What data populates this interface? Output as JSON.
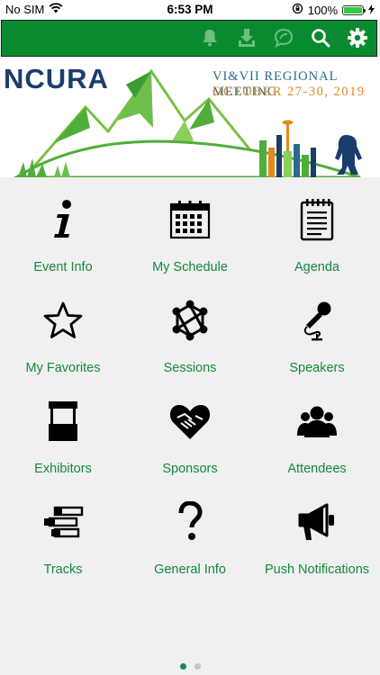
{
  "status_bar": {
    "carrier": "No SIM",
    "time": "6:53 PM",
    "battery": "100%",
    "battery_level": 1.0,
    "wifi_icon": "wifi-icon",
    "rotation_lock_icon": "rotation-lock-icon",
    "charging_icon": "charging-bolt-icon"
  },
  "toolbar": {
    "background": "#0a8a2e",
    "icons": [
      "bell-icon",
      "download-icon",
      "chat-bubble-icon",
      "search-icon",
      "gear-icon"
    ]
  },
  "banner": {
    "logo_text": "NCURA",
    "meeting_title": "VI&VII REGIONAL MEETING",
    "meeting_dates": "OCTOBER 27-30, 2019"
  },
  "menu": [
    {
      "label": "Event Info",
      "icon": "info-icon"
    },
    {
      "label": "My Schedule",
      "icon": "calendar-icon"
    },
    {
      "label": "Agenda",
      "icon": "notepad-icon"
    },
    {
      "label": "My Favorites",
      "icon": "star-icon"
    },
    {
      "label": "Sessions",
      "icon": "network-icon"
    },
    {
      "label": "Speakers",
      "icon": "microphone-icon"
    },
    {
      "label": "Exhibitors",
      "icon": "booth-icon"
    },
    {
      "label": "Sponsors",
      "icon": "handshake-heart-icon"
    },
    {
      "label": "Attendees",
      "icon": "group-icon"
    },
    {
      "label": "Tracks",
      "icon": "tracks-icon"
    },
    {
      "label": "General Info",
      "icon": "question-icon"
    },
    {
      "label": "Push Notifications",
      "icon": "megaphone-icon"
    }
  ],
  "pager": {
    "pages": 2,
    "current": 1
  },
  "colors": {
    "accent": "#0a8a2e",
    "label": "#128a3a",
    "background": "#f0f0f0"
  }
}
